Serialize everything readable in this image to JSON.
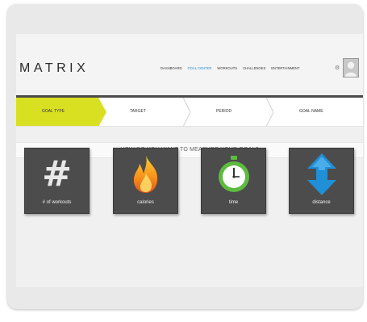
{
  "app": {
    "logo": "MATRIX"
  },
  "nav": {
    "items": [
      {
        "label": "DASHBOARD"
      },
      {
        "label": "GOAL CENTER"
      },
      {
        "label": "WORKOUTS"
      },
      {
        "label": "CHALLENGES"
      },
      {
        "label": "ENTERTAINMENT"
      }
    ],
    "active_index": 1
  },
  "wizard": {
    "steps": [
      {
        "label": "GOAL TYPE",
        "active": true
      },
      {
        "label": "TARGET",
        "active": false
      },
      {
        "label": "PERIOD",
        "active": false
      },
      {
        "label": "GOAL NAME",
        "active": false
      }
    ],
    "question": "HOW DO YOU WANT TO MEASURE YOUR GOAL?"
  },
  "options": [
    {
      "label": "# of workouts",
      "icon": "hash-icon"
    },
    {
      "label": "calories",
      "icon": "flame-icon"
    },
    {
      "label": "time",
      "icon": "stopwatch-icon"
    },
    {
      "label": "distance",
      "icon": "vertical-arrows-icon"
    }
  ],
  "colors": {
    "accent_yellow": "#d9e021",
    "link_blue": "#2b8ad1",
    "tile_bg": "#4c4c4c",
    "frame_bg": "#e9e9e9"
  }
}
